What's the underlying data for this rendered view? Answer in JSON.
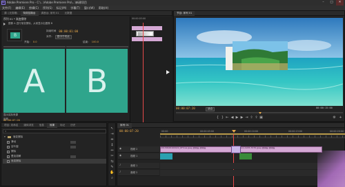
{
  "window": {
    "title": "Adobe Premiere Pro - C:\\...\\Adobe Premiere Pro\\...\\新建项目",
    "app_icon": "Pr",
    "minimize": "–",
    "maximize": "□",
    "close": "✕"
  },
  "menubar": {
    "items": [
      "文件(F)",
      "编辑(E)",
      "剪辑(C)",
      "序列(S)",
      "标记(M)",
      "字幕(T)",
      "窗口(W)",
      "帮助(H)"
    ]
  },
  "effect_controls": {
    "tabs": [
      "源: (无剪辑)",
      "特效控制台",
      "调音台: 序列 01",
      "元数据"
    ],
    "header": "序列 01 * 渐变擦除",
    "desc": "图像 A 进行渐变擦除，从而显示出图像 B",
    "duration_label": "持续时间",
    "duration": "00:00:01:00",
    "align_label": "对齐：",
    "align_value": "居中于切点",
    "start_label": "开始：",
    "start_value": "0.0",
    "end_label": "结束：",
    "end_value": "100.0",
    "show_actual": "显示实际来源",
    "reverse": "反转",
    "block_a": "A",
    "block_b": "B",
    "timecode": "00:00:07:20",
    "mini_ruler_time": "00:00:05:00"
  },
  "monitor": {
    "tabs": [
      "节目: 序列 01"
    ],
    "timecode": "00:00:07:20",
    "fit": "适合",
    "duration": "00:00:15:00",
    "end_timecode": "00:00:15:00"
  },
  "project": {
    "tabs": [
      "项目: 未命名",
      "媒体浏览",
      "信息",
      "效果",
      "标记",
      "历史"
    ],
    "items": [
      "渐变擦除",
      "滑动",
      "百叶窗",
      "擦除",
      "叠加溶解",
      "渐变擦除"
    ]
  },
  "timeline": {
    "tab": "序列 01",
    "timecode": "00:00:07:20",
    "ruler": [
      "00:00",
      "00:00:05:00",
      "00:00:10:00",
      "00:00:15:00",
      "00:00:20:00"
    ],
    "tracks": [
      {
        "name": "视频 2",
        "type": "video"
      },
      {
        "name": "视频 1",
        "type": "video"
      },
      {
        "name": "音频 1",
        "type": "audio"
      },
      {
        "name": "音频 2",
        "type": "audio"
      }
    ],
    "clip1": "20130926160022_RFUsw.jpeg 透明度:透明度",
    "clip2": "ann-1245-7076.jpeg 透明度:透明度",
    "transition_label": "渐变擦除"
  },
  "colors": {
    "accent": "#e8a94a",
    "pink_clip": "#d4a8d4",
    "ab_teal": "#2fa58c",
    "sky_top": "#3e86c4",
    "sea": "#28b4c0"
  }
}
